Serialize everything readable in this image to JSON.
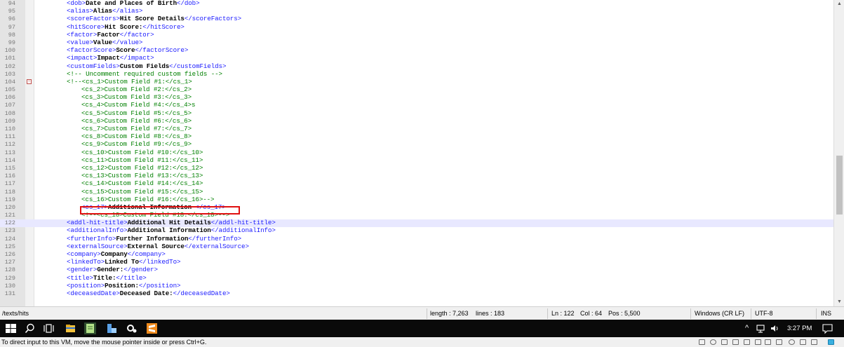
{
  "editor": {
    "lines": [
      {
        "n": "94",
        "parts": [
          [
            "tag",
            "<dob>"
          ],
          [
            "txt",
            "Date and Places of Birth"
          ],
          [
            "tag",
            "</dob>"
          ]
        ]
      },
      {
        "n": "95",
        "parts": [
          [
            "tag",
            "<alias>"
          ],
          [
            "txt",
            "Alias"
          ],
          [
            "tag",
            "</alias>"
          ]
        ]
      },
      {
        "n": "96",
        "parts": [
          [
            "tag",
            "<scoreFactors>"
          ],
          [
            "txt",
            "Hit Score Details"
          ],
          [
            "tag",
            "</scoreFactors>"
          ]
        ]
      },
      {
        "n": "97",
        "parts": [
          [
            "tag",
            "<hitScore>"
          ],
          [
            "txt",
            "Hit Score:"
          ],
          [
            "tag",
            "</hitScore>"
          ]
        ]
      },
      {
        "n": "98",
        "parts": [
          [
            "tag",
            "<factor>"
          ],
          [
            "txt",
            "Factor"
          ],
          [
            "tag",
            "</factor>"
          ]
        ]
      },
      {
        "n": "99",
        "parts": [
          [
            "tag",
            "<value>"
          ],
          [
            "txt",
            "Value"
          ],
          [
            "tag",
            "</value>"
          ]
        ]
      },
      {
        "n": "100",
        "parts": [
          [
            "tag",
            "<factorScore>"
          ],
          [
            "txt",
            "Score"
          ],
          [
            "tag",
            "</factorScore>"
          ]
        ]
      },
      {
        "n": "101",
        "parts": [
          [
            "tag",
            "<impact>"
          ],
          [
            "txt",
            "Impact"
          ],
          [
            "tag",
            "</impact>"
          ]
        ]
      },
      {
        "n": "102",
        "parts": [
          [
            "tag",
            "<customFields>"
          ],
          [
            "txt",
            "Custom Fields"
          ],
          [
            "tag",
            "</customFields>"
          ]
        ]
      },
      {
        "n": "103",
        "parts": [
          [
            "cmt",
            "<!-- Uncomment required custom fields -->"
          ]
        ]
      },
      {
        "n": "104",
        "fold": true,
        "parts": [
          [
            "cmt",
            "<!--<cs_1>Custom Field #1:</cs_1>"
          ]
        ]
      },
      {
        "n": "105",
        "indent": true,
        "parts": [
          [
            "cmt",
            "<cs_2>Custom Field #2:</cs_2>"
          ]
        ]
      },
      {
        "n": "106",
        "indent": true,
        "parts": [
          [
            "cmt",
            "<cs_3>Custom Field #3:</cs_3>"
          ]
        ]
      },
      {
        "n": "107",
        "indent": true,
        "parts": [
          [
            "cmt",
            "<cs_4>Custom Field #4:</cs_4>s"
          ]
        ]
      },
      {
        "n": "108",
        "indent": true,
        "parts": [
          [
            "cmt",
            "<cs_5>Custom Field #5:</cs_5>"
          ]
        ]
      },
      {
        "n": "109",
        "indent": true,
        "parts": [
          [
            "cmt",
            "<cs_6>Custom Field #6:</cs_6>"
          ]
        ]
      },
      {
        "n": "110",
        "indent": true,
        "parts": [
          [
            "cmt",
            "<cs_7>Custom Field #7:</cs_7>"
          ]
        ]
      },
      {
        "n": "111",
        "indent": true,
        "parts": [
          [
            "cmt",
            "<cs_8>Custom Field #8:</cs_8>"
          ]
        ]
      },
      {
        "n": "112",
        "indent": true,
        "parts": [
          [
            "cmt",
            "<cs_9>Custom Field #9:</cs_9>"
          ]
        ]
      },
      {
        "n": "113",
        "indent": true,
        "parts": [
          [
            "cmt",
            "<cs_10>Custom Field #10:</cs_10>"
          ]
        ]
      },
      {
        "n": "114",
        "indent": true,
        "parts": [
          [
            "cmt",
            "<cs_11>Custom Field #11:</cs_11>"
          ]
        ]
      },
      {
        "n": "115",
        "indent": true,
        "parts": [
          [
            "cmt",
            "<cs_12>Custom Field #12:</cs_12>"
          ]
        ]
      },
      {
        "n": "116",
        "indent": true,
        "parts": [
          [
            "cmt",
            "<cs_13>Custom Field #13:</cs_13>"
          ]
        ]
      },
      {
        "n": "117",
        "indent": true,
        "parts": [
          [
            "cmt",
            "<cs_14>Custom Field #14:</cs_14>"
          ]
        ]
      },
      {
        "n": "118",
        "indent": true,
        "parts": [
          [
            "cmt",
            "<cs_15>Custom Field #15:</cs_15>"
          ]
        ]
      },
      {
        "n": "119",
        "indent": true,
        "parts": [
          [
            "cmt",
            "<cs_16>Custom Field #16:</cs_16>-->"
          ]
        ]
      },
      {
        "n": "120",
        "indent": true,
        "highlight": true,
        "parts": [
          [
            "tag",
            "<cs_17>"
          ],
          [
            "txt",
            "Additional Information "
          ],
          [
            "tag",
            "</cs_17>"
          ]
        ]
      },
      {
        "n": "121",
        "indent": true,
        "parts": [
          [
            "cmt",
            "<!--<cs_18>Custom Field #18:</cs_18>-->"
          ]
        ]
      },
      {
        "n": "122",
        "current": true,
        "parts": [
          [
            "tag",
            "<addl-hit-title>"
          ],
          [
            "txt",
            "Additional Hit Details"
          ],
          [
            "tag",
            "</addl-hit-title>"
          ]
        ]
      },
      {
        "n": "123",
        "parts": [
          [
            "tag",
            "<additionalInfo>"
          ],
          [
            "txt",
            "Additional Information"
          ],
          [
            "tag",
            "</additionalInfo>"
          ]
        ]
      },
      {
        "n": "124",
        "parts": [
          [
            "tag",
            "<furtherInfo>"
          ],
          [
            "txt",
            "Further Information"
          ],
          [
            "tag",
            "</furtherInfo>"
          ]
        ]
      },
      {
        "n": "125",
        "parts": [
          [
            "tag",
            "<externalSource>"
          ],
          [
            "txt",
            "External Source"
          ],
          [
            "tag",
            "</externalSource>"
          ]
        ]
      },
      {
        "n": "126",
        "parts": [
          [
            "tag",
            "<company>"
          ],
          [
            "txt",
            "Company"
          ],
          [
            "tag",
            "</company>"
          ]
        ]
      },
      {
        "n": "127",
        "parts": [
          [
            "tag",
            "<linkedTo>"
          ],
          [
            "txt",
            "Linked To"
          ],
          [
            "tag",
            "</linkedTo>"
          ]
        ]
      },
      {
        "n": "128",
        "parts": [
          [
            "tag",
            "<gender>"
          ],
          [
            "txt",
            "Gender:"
          ],
          [
            "tag",
            "</gender>"
          ]
        ]
      },
      {
        "n": "129",
        "parts": [
          [
            "tag",
            "<title>"
          ],
          [
            "txt",
            "Title:"
          ],
          [
            "tag",
            "</title>"
          ]
        ]
      },
      {
        "n": "130",
        "parts": [
          [
            "tag",
            "<position>"
          ],
          [
            "txt",
            "Position:"
          ],
          [
            "tag",
            "</position>"
          ]
        ]
      },
      {
        "n": "131",
        "parts": [
          [
            "tag",
            "<deceasedDate>"
          ],
          [
            "txt",
            "Deceased Date:"
          ],
          [
            "tag",
            "</deceasedDate>"
          ]
        ]
      }
    ]
  },
  "statusbar": {
    "path": "/texts/hits",
    "length": "length : 7,263",
    "lines": "lines : 183",
    "ln": "Ln : 122",
    "col": "Col : 64",
    "pos": "Pos : 5,500",
    "eol": "Windows (CR LF)",
    "encoding": "UTF-8",
    "mode": "INS"
  },
  "taskbar": {
    "time": "3:27 PM",
    "icons": [
      "windows-start-icon",
      "search-icon",
      "task-view-icon",
      "file-explorer-icon",
      "notepad-plus-plus-icon",
      "app-icon",
      "settings-gear-icon",
      "sublime-icon"
    ],
    "tray": {
      "chevron": "^",
      "network_icon": "network-icon",
      "volume_icon": "volume-icon",
      "notification_icon": "notification-icon"
    }
  },
  "vmbar": {
    "message": "To direct input to this VM, move the mouse pointer inside or press Ctrl+G."
  },
  "colors": {
    "tag": "#1a1aff",
    "text": "#000000",
    "comment": "#008000",
    "highlight_box": "#e01010",
    "current_line": "#e8e8ff"
  }
}
